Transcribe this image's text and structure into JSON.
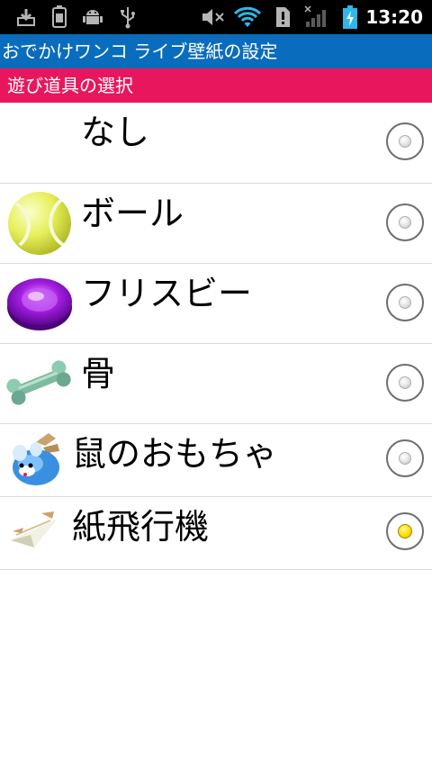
{
  "status_bar": {
    "time": "13:20",
    "icons": [
      "download-icon",
      "sim-card-icon",
      "android-debug-icon",
      "usb-icon",
      "speaker-muted-icon",
      "wifi-icon",
      "alert-icon",
      "signal-no-service-icon",
      "battery-charging-icon"
    ]
  },
  "app": {
    "title": "おでかけワンコ ライブ壁紙の設定"
  },
  "dialog": {
    "heading": "遊び道具の選択"
  },
  "options": [
    {
      "label": "なし",
      "icon": "",
      "selected": false
    },
    {
      "label": "ボール",
      "icon": "tennis-ball-icon",
      "selected": false
    },
    {
      "label": "フリスビー",
      "icon": "frisbee-icon",
      "selected": false
    },
    {
      "label": "骨",
      "icon": "bone-icon",
      "selected": false
    },
    {
      "label": "鼠のおもちゃ",
      "icon": "toy-mouse-icon",
      "selected": false
    },
    {
      "label": "紙飛行機",
      "icon": "paper-airplane-icon",
      "selected": true
    }
  ],
  "colors": {
    "title_bar": "#0a6cbc",
    "header_bar": "#e8175d",
    "selected_radio": "#ffe000"
  }
}
